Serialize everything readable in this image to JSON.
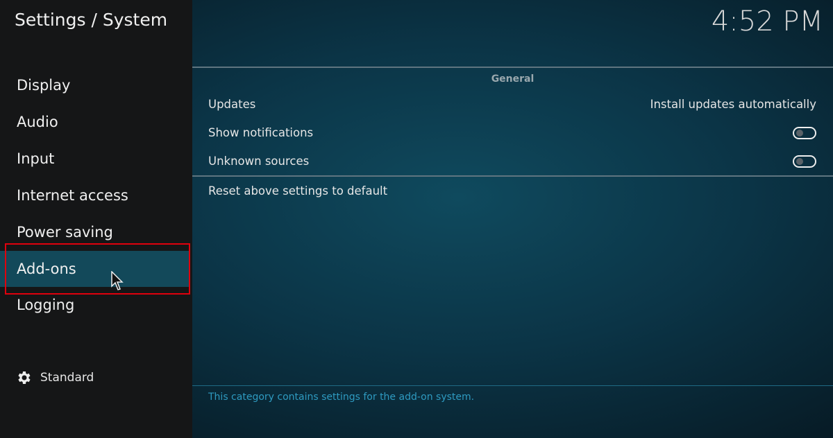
{
  "header": {
    "title": "Settings / System",
    "clock": "4:52 PM"
  },
  "sidebar": {
    "items": [
      {
        "label": "Display"
      },
      {
        "label": "Audio"
      },
      {
        "label": "Input"
      },
      {
        "label": "Internet access"
      },
      {
        "label": "Power saving"
      },
      {
        "label": "Add-ons",
        "selected": true
      },
      {
        "label": "Logging"
      }
    ],
    "level_label": "Standard",
    "level_icon": "gear-icon"
  },
  "main": {
    "group": "General",
    "rows": [
      {
        "label": "Updates",
        "value": "Install updates automatically"
      },
      {
        "label": "Show notifications",
        "toggle": false
      },
      {
        "label": "Unknown sources",
        "toggle": false
      }
    ],
    "reset": "Reset above settings to default",
    "description": "This category contains settings for the add-on system."
  },
  "colors": {
    "highlight": "#e0000d",
    "selected": "#13495a",
    "accent": "#2e9ac0"
  }
}
